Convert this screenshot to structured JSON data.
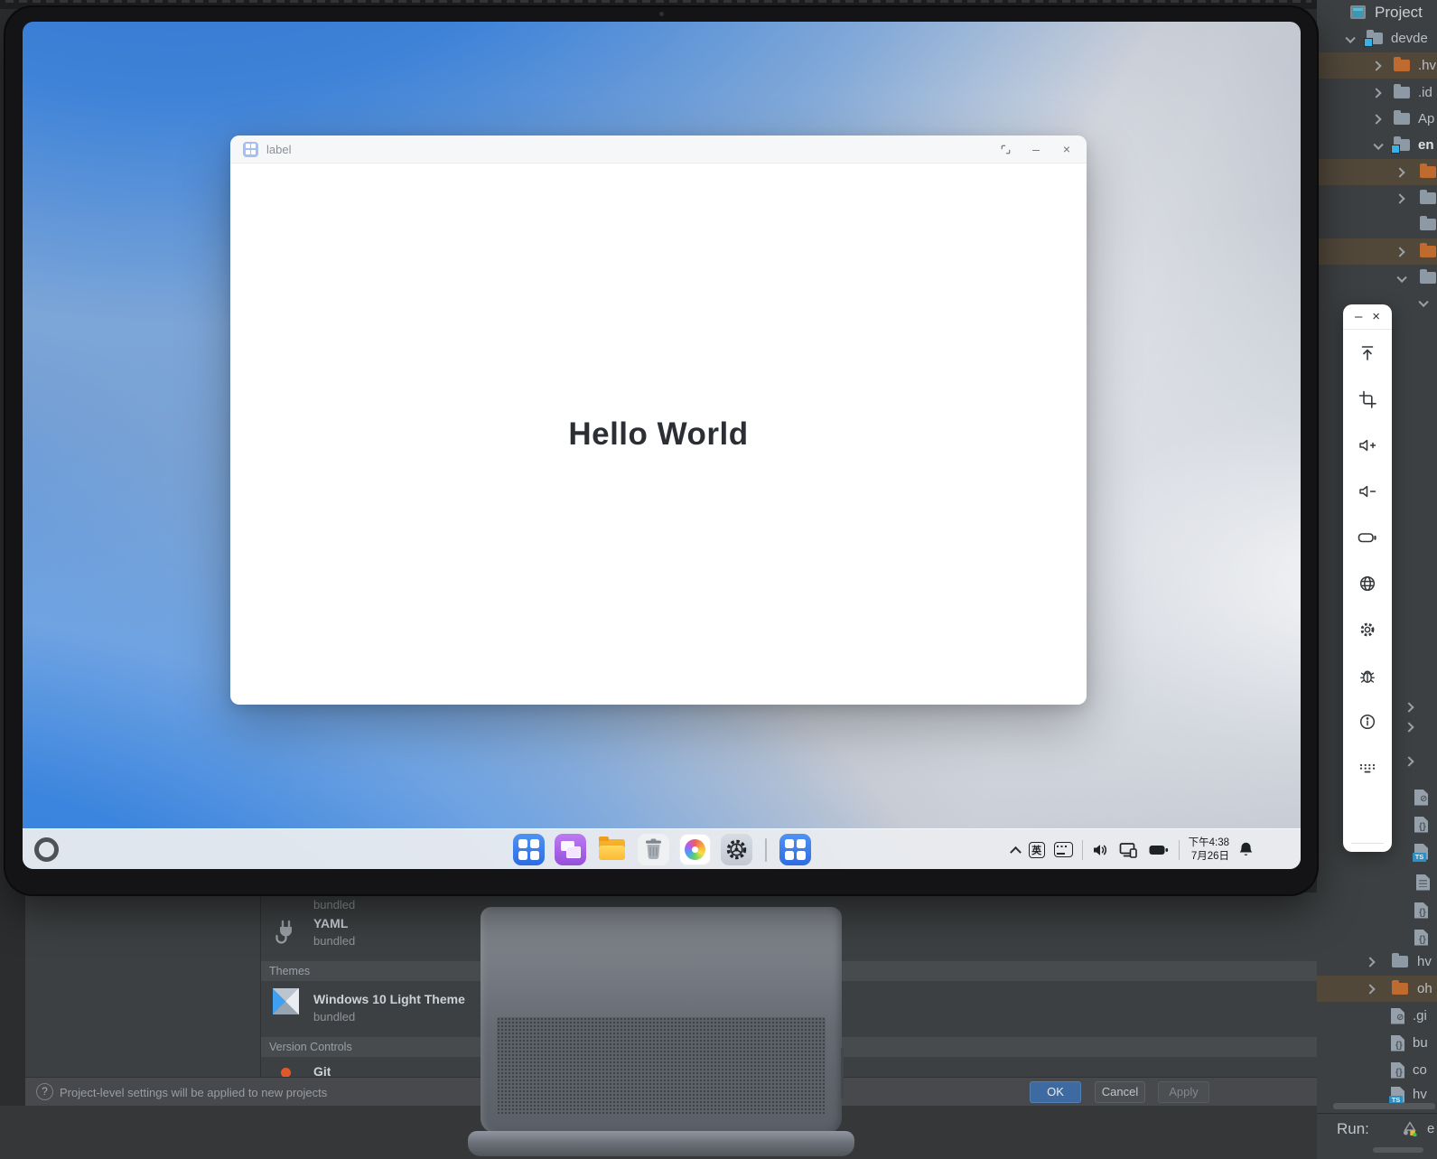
{
  "emulator": {
    "window": {
      "title": "label",
      "content": "Hello World",
      "controls": {
        "minimize": "–",
        "close": "×"
      }
    },
    "taskbar": {
      "ime": "英",
      "time": "下午4:38",
      "date": "7月26日"
    },
    "toolbar": {
      "minimize": "–",
      "close": "×"
    }
  },
  "ide": {
    "project_panel": {
      "title": "Project",
      "tree_top": [
        {
          "label": "devde"
        },
        {
          "label": ".hv"
        },
        {
          "label": ".id"
        },
        {
          "label": "Ap"
        },
        {
          "label": "en"
        }
      ],
      "tree_bottom": [
        {
          "label": "hv"
        },
        {
          "label": "oh"
        },
        {
          "label": ".gi"
        },
        {
          "label": "bu"
        },
        {
          "label": "co"
        },
        {
          "label": "hv"
        }
      ],
      "run_label": "Run:",
      "run_config": "e"
    },
    "settings_dialog": {
      "truncated_status": "bundled",
      "plugin": {
        "name": "YAML",
        "status": "bundled"
      },
      "themes_header": "Themes",
      "theme": {
        "name": "Windows 10 Light Theme",
        "status": "bundled"
      },
      "vcs_header": "Version Controls",
      "vcs_item": "Git",
      "hint": "Project-level settings will be applied to new projects",
      "buttons": {
        "ok": "OK",
        "cancel": "Cancel",
        "apply": "Apply"
      }
    }
  }
}
